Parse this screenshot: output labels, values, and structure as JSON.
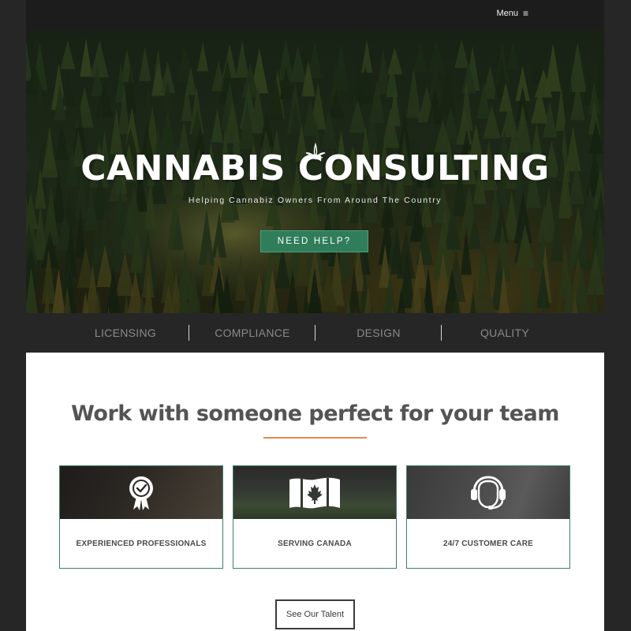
{
  "nav": {
    "menu_label": "Menu",
    "menu_icon": "hamburger-icon"
  },
  "hero": {
    "title": "CANNABIS CONSULTING",
    "subtitle": "Helping Cannabiz Owners From Around The Country",
    "cta_label": "NEED HELP?",
    "logo_icon": "cannabis-leaf-icon"
  },
  "services": [
    {
      "label": "LICENSING"
    },
    {
      "label": "COMPLIANCE"
    },
    {
      "label": "DESIGN"
    },
    {
      "label": "QUALITY"
    }
  ],
  "work": {
    "title": "Work with someone perfect for your team",
    "cards": [
      {
        "label": "EXPERIENCED PROFESSIONALS",
        "icon": "award-badge-icon"
      },
      {
        "label": "SERVING CANADA",
        "icon": "canada-flag-icon"
      },
      {
        "label": "24/7 CUSTOMER CARE",
        "icon": "headset-icon"
      }
    ],
    "button_label": "See Our Talent"
  },
  "colors": {
    "accent_green": "#2f7d5b",
    "underline_orange": "#e58a4a",
    "dark_background": "#262626"
  }
}
